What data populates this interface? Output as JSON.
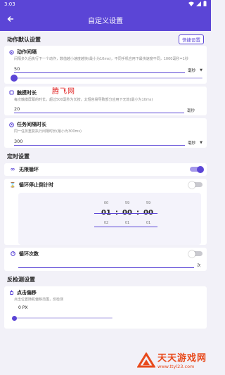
{
  "status": {
    "time": "3:03"
  },
  "header": {
    "title": "自定义设置",
    "back_icon": "arrow-left-icon"
  },
  "action_defaults": {
    "section_title": "动作默认设置",
    "quick_button": "快捷设置",
    "action_interval": {
      "label": "动作间隔",
      "desc": "间隔多久后执行下一个动作，数值越小速度越快(最小为10ms)，不同手机应用下最快速度不同，1000毫秒=1秒",
      "value": "50",
      "unit": "毫秒",
      "slider_fraction": 0.0
    },
    "touch_duration": {
      "label": "触摸时长",
      "desc": "每次触摸屏幕的时长，超过500毫秒为长按，太短容易导致部分应用下无效(最小为10ms)",
      "value": "20",
      "unit": "毫秒"
    },
    "task_interval": {
      "label": "任务间隔时长",
      "desc": "同一任务重复执行间隔时长(最小为300ms)",
      "value": "300",
      "unit": "毫秒"
    }
  },
  "timer_settings": {
    "section_title": "定时设置",
    "infinite_loop": {
      "label": "无限循环",
      "on": true
    },
    "loop_stop_countdown": {
      "label": "循环停止倒计时",
      "on": false,
      "above": [
        "00",
        "59",
        "59"
      ],
      "main": [
        "01",
        "00",
        "00"
      ],
      "below": [
        "02",
        "01",
        "01"
      ]
    },
    "loop_count": {
      "label": "循环次数",
      "on": false,
      "unit": "次"
    }
  },
  "anti_detect": {
    "section_title": "反检测设置",
    "click_offset": {
      "label": "点击偏移",
      "desc": "点击位置随机偏移范围，反检测",
      "value": "0 PX",
      "slider_fraction": 0.0
    }
  },
  "overlays": {
    "watermark": "腾飞网",
    "brand_name": "天天游戏网",
    "brand_url": "www.ttyl23.com"
  },
  "colors": {
    "accent": "#5b45d6",
    "background": "#f2f1f8"
  }
}
